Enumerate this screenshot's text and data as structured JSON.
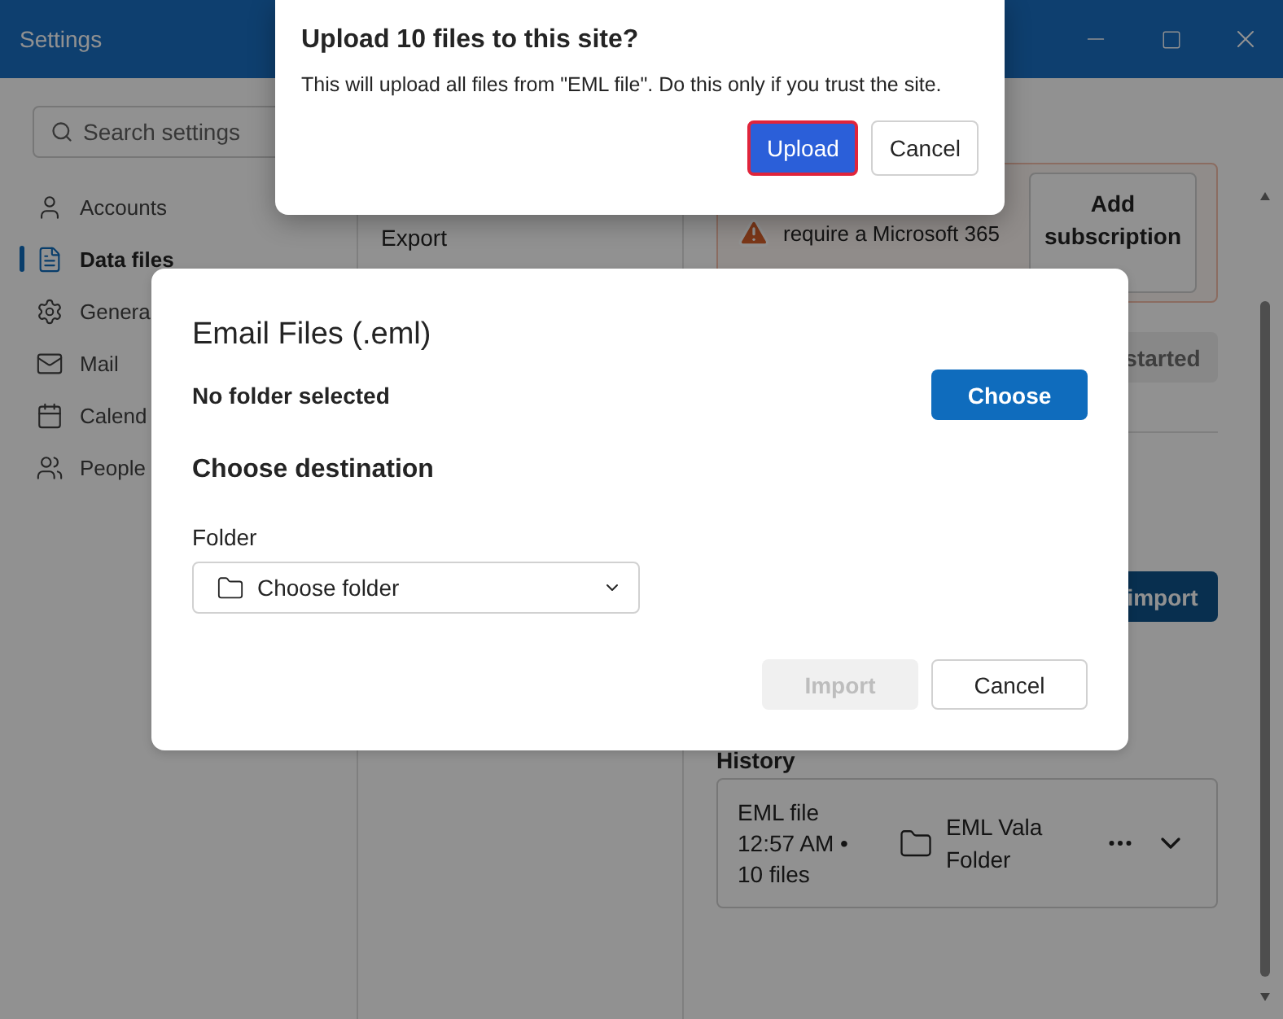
{
  "window": {
    "title": "Settings"
  },
  "search": {
    "placeholder": "Search settings"
  },
  "sidebar": {
    "items": [
      {
        "label": "Accounts",
        "selected": false
      },
      {
        "label": "Data files",
        "selected": true
      },
      {
        "label": "Genera",
        "selected": false
      },
      {
        "label": "Mail",
        "selected": false
      },
      {
        "label": "Calend",
        "selected": false
      },
      {
        "label": "People",
        "selected": false
      }
    ]
  },
  "middle": {
    "items": [
      "Export"
    ]
  },
  "subscription_notice": {
    "text": "require a Microsoft 365",
    "action": "Add subscription"
  },
  "get_started_button": {
    "label": "started",
    "disabled": true
  },
  "import_button": {
    "label": "import",
    "disabled": false
  },
  "history": {
    "title": "History",
    "entries": [
      {
        "name": "EML file",
        "time": "12:57 AM •",
        "count": "10 files",
        "folder": "EML Vala Folder"
      }
    ]
  },
  "email_dialog": {
    "title": "Email Files (.eml)",
    "status": "No folder selected",
    "choose_button": "Choose",
    "section": "Choose destination",
    "folder_label": "Folder",
    "folder_placeholder": "Choose folder",
    "buttons": [
      {
        "label": "Import",
        "disabled": true
      },
      {
        "label": "Cancel",
        "disabled": false
      }
    ]
  },
  "upload_dialog": {
    "title": "Upload 10 files to this site?",
    "message": "This will upload all files from \"EML file\". Do this only if you trust the site.",
    "buttons": [
      {
        "label": "Upload",
        "primary": true,
        "focused": true
      },
      {
        "label": "Cancel",
        "primary": false,
        "focused": false
      }
    ]
  }
}
